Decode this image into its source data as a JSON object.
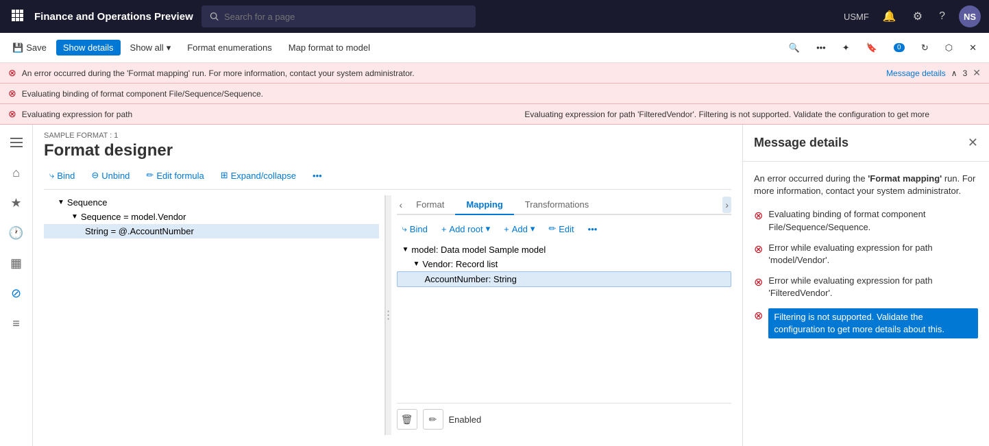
{
  "app": {
    "title": "Finance and Operations Preview",
    "search_placeholder": "Search for a page",
    "user_region": "USMF",
    "user_initials": "NS"
  },
  "command_bar": {
    "save_label": "Save",
    "show_details_label": "Show details",
    "show_all_label": "Show all",
    "format_enumerations_label": "Format enumerations",
    "map_format_to_model_label": "Map format to model",
    "badge_count": "0"
  },
  "errors": {
    "main_error": "An error occurred during the 'Format mapping' run. For more information, contact your system administrator.",
    "message_details_link": "Message details",
    "error_count": "3",
    "error2": "Evaluating binding of format component File/Sequence/Sequence.",
    "error3_short": "Evaluating expression for path",
    "error3_full": "Evaluating expression for path 'FilteredVendor'. Filtering is not supported. Validate the configuration to get more"
  },
  "designer": {
    "sample_label": "SAMPLE FORMAT : 1",
    "title": "Format designer",
    "toolbar": {
      "bind_label": "Bind",
      "unbind_label": "Unbind",
      "edit_formula_label": "Edit formula",
      "expand_collapse_label": "Expand/collapse"
    },
    "left_tree": {
      "root_label": "Sequence",
      "child1_label": "Sequence = model.Vendor",
      "child1_1_label": "String = @.AccountNumber"
    },
    "tabs": {
      "format_label": "Format",
      "mapping_label": "Mapping",
      "transformations_label": "Transformations"
    },
    "right_toolbar": {
      "bind_label": "Bind",
      "add_root_label": "Add root",
      "add_label": "Add",
      "edit_label": "Edit"
    },
    "model_tree": {
      "root_label": "model: Data model Sample model",
      "vendor_label": "Vendor: Record list",
      "account_number_label": "AccountNumber: String"
    },
    "bottom": {
      "status_label": "Enabled"
    }
  },
  "message_details_panel": {
    "title": "Message details",
    "intro": "An error occurred during the 'Format mapping' run. For more information, contact your system administrator.",
    "errors": [
      "Evaluating binding of format component File/Sequence/Sequence.",
      "Error while evaluating expression for path 'model/Vendor'.",
      "Error while evaluating expression for path 'FilteredVendor'.",
      "Filtering is not supported. Validate the configuration to get more details about this."
    ]
  },
  "icons": {
    "grid": "⊞",
    "bell": "🔔",
    "gear": "⚙",
    "question": "?",
    "search": "🔍",
    "home": "⌂",
    "star": "★",
    "clock": "🕐",
    "table": "▦",
    "list": "≡",
    "filter": "⊘",
    "save": "💾",
    "chevron_down": "▾",
    "chevron_left": "‹",
    "more": "•••",
    "close": "✕",
    "error_circle": "⊗",
    "arrow_up": "∧",
    "arrow_right": "›",
    "bind_icon": "⤷",
    "unbind_icon": "⊖",
    "edit_icon": "✏",
    "expand_icon": "⊞",
    "plus": "+",
    "trash": "🗑",
    "pencil": "✏"
  }
}
